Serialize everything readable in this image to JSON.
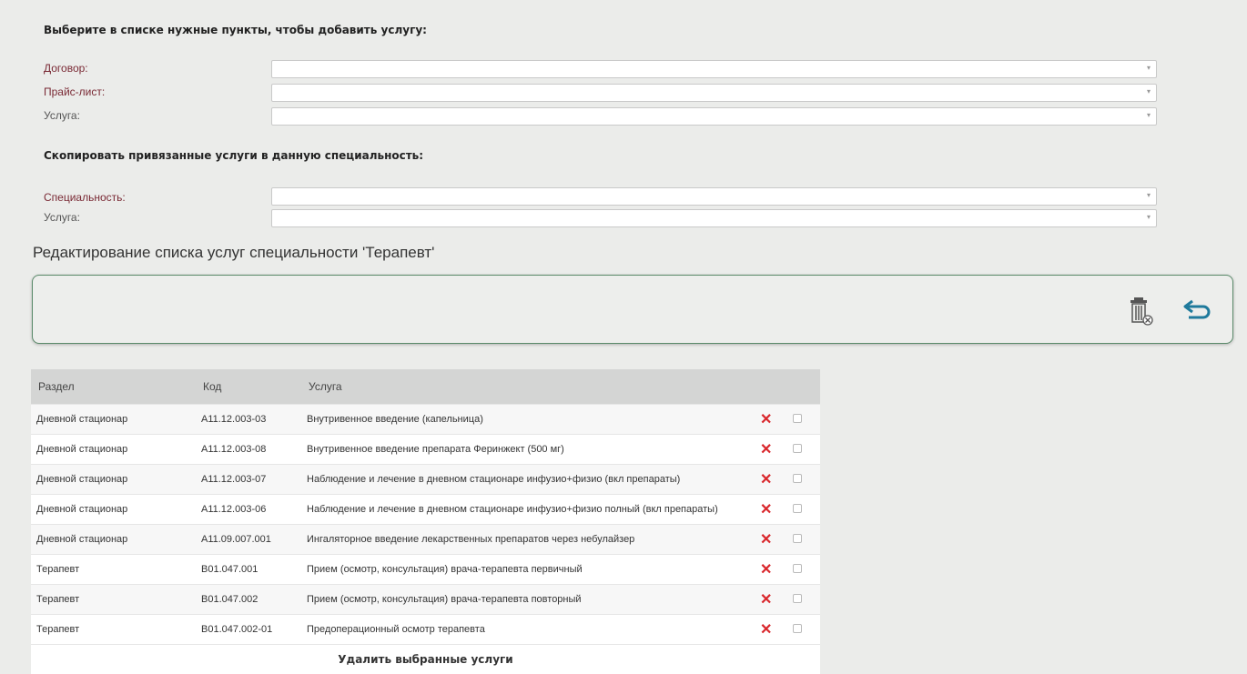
{
  "add_section": {
    "title": "Выберите в списке нужные пункты, чтобы добавить услугу:",
    "fields": [
      {
        "label": "Договор:",
        "value": ""
      },
      {
        "label": "Прайс-лист:",
        "value": ""
      },
      {
        "label": "Услуга:",
        "value": ""
      }
    ]
  },
  "copy_section": {
    "title": "Скопировать привязанные услуги в данную специальность:",
    "fields": [
      {
        "label": "Специальность:",
        "value": ""
      },
      {
        "label": "Услуга:",
        "value": ""
      }
    ]
  },
  "edit_title": "Редактирование списка услуг специальности 'Терапевт'",
  "toolbar": {
    "icons": [
      "delete-trash-icon",
      "undo-return-icon"
    ]
  },
  "table": {
    "headers": [
      "Раздел",
      "Код",
      "Услуга"
    ],
    "rows": [
      {
        "section": "Дневной стационар",
        "code": "A11.12.003-03",
        "service": "Внутривенное введение (капельница)"
      },
      {
        "section": "Дневной стационар",
        "code": "A11.12.003-08",
        "service": "Внутривенное введение препарата Феринжект (500 мг)"
      },
      {
        "section": "Дневной стационар",
        "code": "A11.12.003-07",
        "service": "Наблюдение и лечение в дневном стационаре инфузио+физио (вкл препараты)"
      },
      {
        "section": "Дневной стационар",
        "code": "A11.12.003-06",
        "service": "Наблюдение и лечение в дневном стационаре инфузио+физио полный (вкл препараты)"
      },
      {
        "section": "Дневной стационар",
        "code": "A11.09.007.001",
        "service": "Ингаляторное введение лекарственных препаратов через небулайзер"
      },
      {
        "section": "Терапевт",
        "code": "B01.047.001",
        "service": "Прием (осмотр, консультация) врача-терапевта первичный"
      },
      {
        "section": "Терапевт",
        "code": "B01.047.002",
        "service": "Прием (осмотр, консультация) врача-терапевта повторный"
      },
      {
        "section": "Терапевт",
        "code": "B01.047.002-01",
        "service": "Предоперационный осмотр терапевта"
      }
    ],
    "delete_selected_label": "Удалить выбранные услуги"
  },
  "colors": {
    "accent_delete": "#d9262b",
    "label": "#7a2a35",
    "toolbar_border": "#5a8a6a"
  }
}
